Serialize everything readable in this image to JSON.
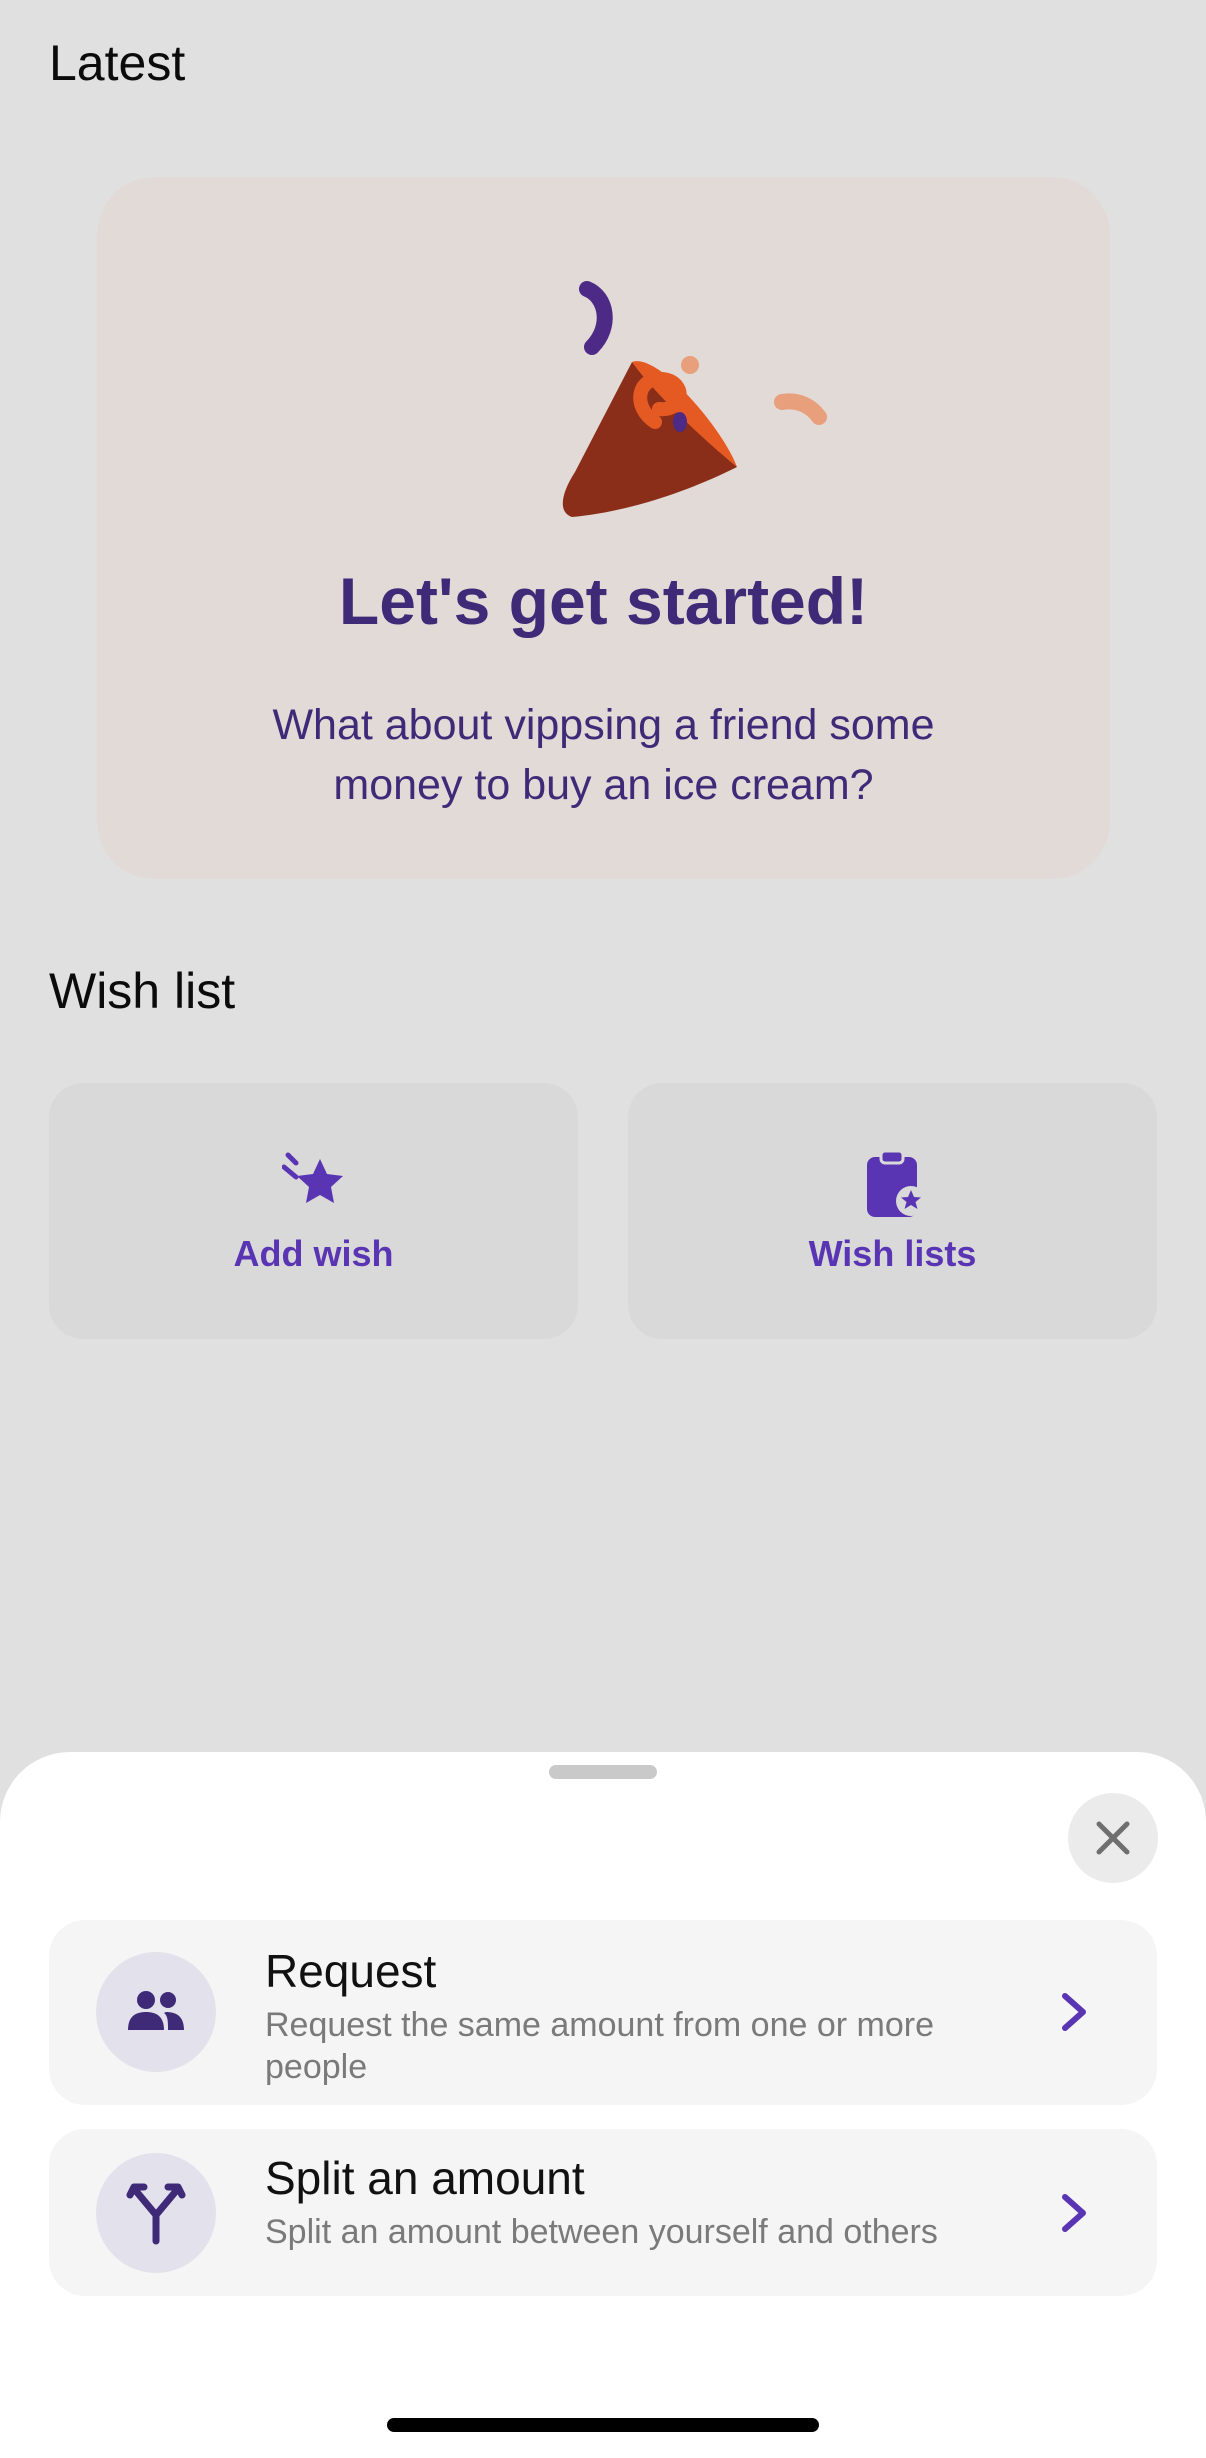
{
  "latest": {
    "title": "Latest"
  },
  "promo": {
    "heading": "Let's get started!",
    "body": "What about vippsing a friend some money to buy an ice cream?",
    "illustration": "party-popper-icon"
  },
  "wishlist": {
    "title": "Wish list",
    "tiles": [
      {
        "label": "Add wish",
        "icon": "shooting-star-icon"
      },
      {
        "label": "Wish lists",
        "icon": "clipboard-star-icon"
      }
    ]
  },
  "sheet": {
    "close_icon": "close-icon",
    "actions": [
      {
        "title": "Request",
        "description": "Request the same amount from one or more people",
        "icon": "people-icon"
      },
      {
        "title": "Split an amount",
        "description": "Split an amount between yourself and others",
        "icon": "split-arrows-icon"
      }
    ]
  },
  "colors": {
    "accent": "#5a35b3",
    "heading": "#3f2a78",
    "background": "#e0e0e0",
    "promo_card": "#e2dad7",
    "sheet": "#ffffff"
  }
}
